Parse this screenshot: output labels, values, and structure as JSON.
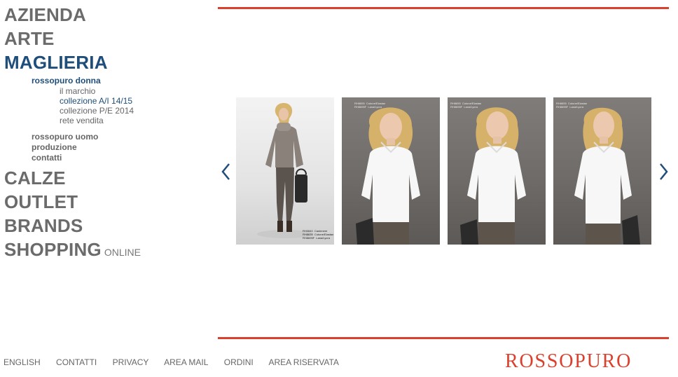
{
  "nav": {
    "azienda": "AZIENDA",
    "arte": "ARTE",
    "maglieria": "MAGLIERIA",
    "rossopuro_donna": "rossopuro donna",
    "il_marchio": "il marchio",
    "collezione_ai": "collezione A/I 14/15",
    "collezione_pe": "collezione P/E 2014",
    "rete_vendita": "rete vendita",
    "rossopuro_uomo": "rossopuro uomo",
    "produzione": "produzione",
    "contatti": "contatti",
    "calze": "CALZE",
    "outlet": "OUTLET",
    "brands": "BRANDS",
    "shopping": "SHOPPING",
    "online": "ONLINE"
  },
  "gallery": {
    "photos": [
      {
        "caption": "RH0840  Cashmere\nRH8635  Cotone/Elastan\nRH8695F  Lana/Lycra"
      },
      {
        "caption": "RH8655  Cotone/Elastan\nRH8695F  Lana/Lycra"
      },
      {
        "caption": "RH8655  Cotone/Elastan\nRH8695F  Lana/Lycra"
      },
      {
        "caption": "RH8655  Cotone/Elastan\nRH8695F  Lana/Lycra"
      }
    ],
    "prev_icon": "chevron-left-icon",
    "next_icon": "chevron-right-icon"
  },
  "footer": {
    "english": "ENGLISH",
    "contatti": "CONTATTI",
    "privacy": "PRIVACY",
    "area_mail": "AREA MAIL",
    "ordini": "ORDINI",
    "area_riservata": "AREA RISERVATA"
  },
  "brand": {
    "logo": "ROSSOPURO"
  },
  "colors": {
    "accent_red": "#d9412e",
    "active_blue": "#1f4e7a",
    "nav_gray": "#6b6b6b"
  }
}
